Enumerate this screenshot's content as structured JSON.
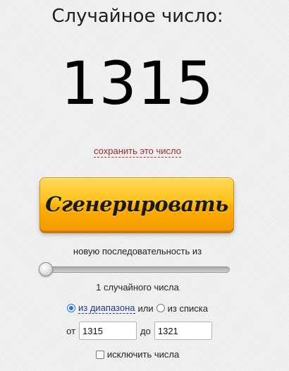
{
  "title": "Случайное число:",
  "result": "1315",
  "save_link": "сохранить это число",
  "generate_button": "Сгенерировать",
  "sequence_label": "новую последовательность из",
  "sequence": {
    "count": 1,
    "count_label": "1 случайного числа"
  },
  "mode": {
    "range_label": "из диапазона",
    "or_label": "или",
    "list_label": "из списка",
    "selected": "range"
  },
  "range": {
    "from_label": "от",
    "from_value": "1315",
    "to_label": "до",
    "to_value": "1321"
  },
  "exclude": {
    "label": "исключить числа",
    "checked": false
  },
  "colors": {
    "button": "#ffb400",
    "save_link": "#9a2a2a",
    "range_link": "#1e3a8a",
    "radio_accent": "#1a73e8"
  }
}
